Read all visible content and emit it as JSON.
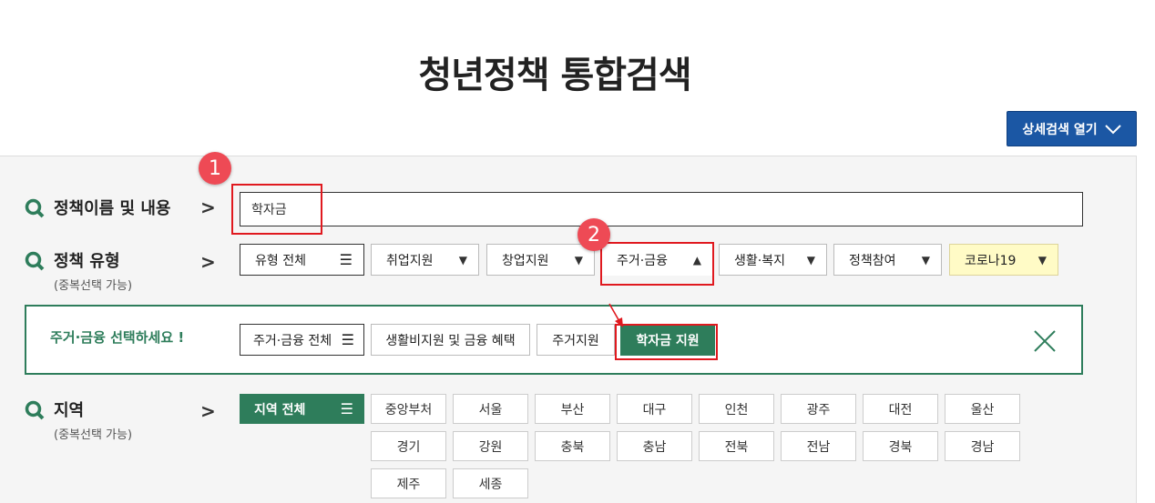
{
  "title": "청년정책 통합검색",
  "detail_search_btn": "상세검색 열기",
  "rows": {
    "name": {
      "label": "정책이름 및 내용"
    },
    "type": {
      "label": "정책 유형",
      "sub": "(중복선택 가능)"
    },
    "region": {
      "label": "지역",
      "sub": "(중복선택 가능)"
    }
  },
  "search_input_value": "학자금",
  "type_selects": [
    {
      "label": "유형 전체",
      "icon": "menu-icon"
    },
    {
      "label": "취업지원",
      "icon": "caret-down"
    },
    {
      "label": "창업지원",
      "icon": "caret-down"
    },
    {
      "label": "주거·금융",
      "icon": "caret-up"
    },
    {
      "label": "생활·복지",
      "icon": "caret-down"
    },
    {
      "label": "정책참여",
      "icon": "caret-down"
    },
    {
      "label": "코로나19",
      "icon": "caret-down"
    }
  ],
  "sub_panel": {
    "title": "주거·금융 선택하세요 !",
    "options": [
      "주거·금융 전체",
      "생활비지원 및 금융 혜택",
      "주거지원",
      "학자금 지원"
    ]
  },
  "region_all": "지역 전체",
  "regions": [
    "중앙부처",
    "서울",
    "부산",
    "대구",
    "인천",
    "광주",
    "대전",
    "울산",
    "경기",
    "강원",
    "충북",
    "충남",
    "전북",
    "전남",
    "경북",
    "경남",
    "제주",
    "세종"
  ],
  "annotations": [
    "1",
    "2"
  ],
  "glyphs": {
    "chevron": ">",
    "caret_down": "▼",
    "caret_up": "▲",
    "menu": "☰"
  },
  "colors": {
    "accent_green": "#2e7d5b",
    "brand_blue": "#1b57a4",
    "highlight_red": "#e0191f",
    "badge_red": "#ee4a55"
  }
}
